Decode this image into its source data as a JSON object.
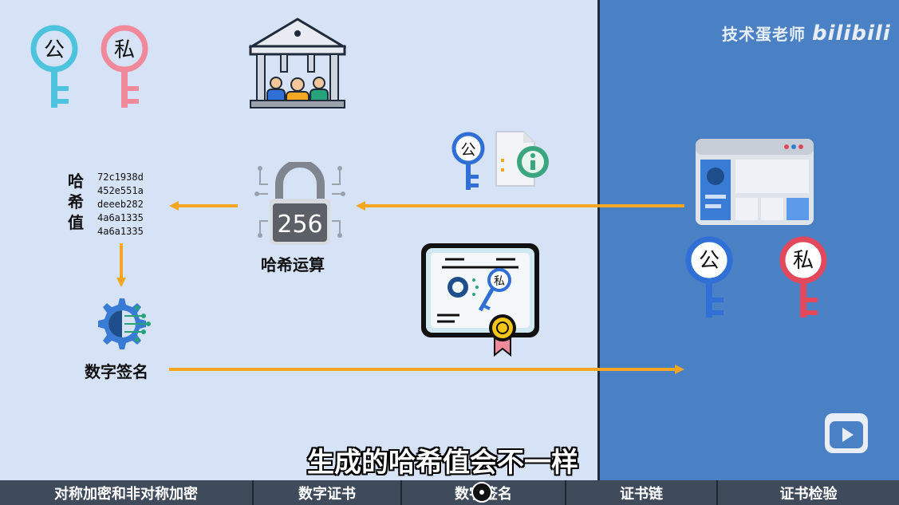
{
  "watermark": {
    "channel": "技术蛋老师",
    "logo": "bilibili"
  },
  "keys": {
    "public": "公",
    "private": "私"
  },
  "hash": {
    "label_chars": [
      "哈",
      "希",
      "值"
    ],
    "values": [
      "72c1938d",
      "452e551a",
      "deeeb282",
      "4a6a1335",
      "4a6a1335"
    ]
  },
  "lock_number": "256",
  "captions": {
    "hash_op": "哈希运算",
    "digital_signature": "数字签名"
  },
  "subtitle": "生成的哈希值会不一样",
  "chapters": [
    "对称加密和非对称加密",
    "数字证书",
    "数字签名",
    "证书链",
    "证书检验"
  ],
  "colors": {
    "arrow": "#f5a623",
    "public_key_left": "#4ec3dd",
    "private_key_left": "#f08a9a",
    "public_key_right": "#2f6fd6",
    "private_key_right": "#e2475b"
  }
}
